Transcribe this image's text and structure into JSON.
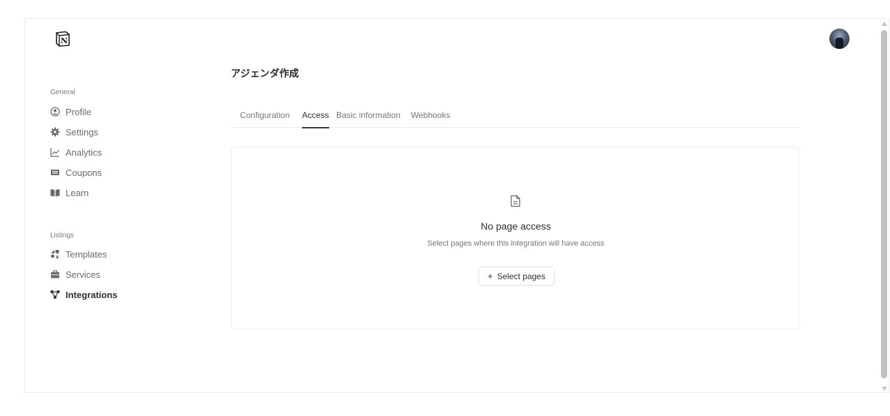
{
  "brand": {
    "logo_letter": "N"
  },
  "sidebar": {
    "general_label": "General",
    "general_items": [
      {
        "label": "Profile",
        "icon": "person-circle-icon"
      },
      {
        "label": "Settings",
        "icon": "gear-icon"
      },
      {
        "label": "Analytics",
        "icon": "line-chart-icon"
      },
      {
        "label": "Coupons",
        "icon": "ticket-icon"
      },
      {
        "label": "Learn",
        "icon": "book-icon"
      }
    ],
    "listings_label": "Listings",
    "listings_items": [
      {
        "label": "Templates",
        "icon": "shapes-icon"
      },
      {
        "label": "Services",
        "icon": "briefcase-icon"
      },
      {
        "label": "Integrations",
        "icon": "nodes-icon",
        "active": true
      }
    ]
  },
  "main": {
    "title": "アジェンダ作成",
    "tabs": [
      {
        "label": "Configuration"
      },
      {
        "label": "Access",
        "active": true
      },
      {
        "label": "Basic information"
      },
      {
        "label": "Webhooks"
      }
    ],
    "empty_state": {
      "icon": "document-icon",
      "title": "No page access",
      "subtitle": "Select pages where this integration will have access",
      "button_label": "Select pages",
      "button_icon": "plus-icon"
    }
  },
  "colors": {
    "text": "#37352f",
    "muted": "#787774",
    "border": "#ececea"
  }
}
